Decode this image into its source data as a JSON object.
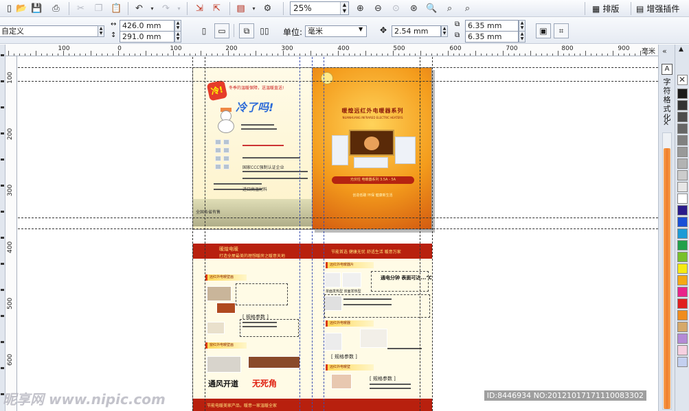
{
  "toolbar": {
    "zoom_value": "25%",
    "layout_label": "排版",
    "plugin_label": "增强插件",
    "icons": [
      "open-icon",
      "save-icon",
      "print-icon",
      "cut-icon",
      "copy-icon",
      "paste-icon",
      "undo-icon",
      "redo-icon",
      "import-icon",
      "export-icon",
      "publish-icon",
      "settings-icon",
      "zoom-in-icon",
      "zoom-out-icon",
      "zoom-fit-icon",
      "zoom-page-icon",
      "zoom-width-icon",
      "zoom-height-icon"
    ]
  },
  "property_bar": {
    "page_preset": "自定义",
    "width": "426.0 mm",
    "height": "291.0 mm",
    "unit_label": "单位:",
    "unit_value": "毫米",
    "nudge": "2.54 mm",
    "dup_x": "6.35 mm",
    "dup_y": "6.35 mm"
  },
  "ruler": {
    "h_labels": [
      "100",
      "0",
      "100",
      "200",
      "300",
      "400",
      "500",
      "600",
      "700",
      "800",
      "900"
    ],
    "unit": "毫米",
    "v_labels": [
      "100",
      "200",
      "300",
      "400",
      "500",
      "600"
    ]
  },
  "docker": {
    "title": "字符格式化"
  },
  "palette": {
    "colors": [
      "#1a1a1a",
      "#333333",
      "#4d4d4d",
      "#666666",
      "#808080",
      "#999999",
      "#b3b3b3",
      "#cccccc",
      "#e6e6e6",
      "#ffffff",
      "#2a1a8a",
      "#1a4fd6",
      "#1c9ad6",
      "#22a04a",
      "#78c02a",
      "#f5ea14",
      "#f5a714",
      "#e8238a",
      "#e01f1f",
      "#f08c1e",
      "#d6a96a",
      "#b48ad6",
      "#f5d0e0",
      "#c4d0f0"
    ]
  },
  "artwork": {
    "front_badge": "冷!",
    "front_tagline": "冬季的温暖保障，送温暖直送!",
    "front_title": "冷了吗!",
    "front_cert": "国家CCC强制认证企业",
    "front_material": "进口高温材料",
    "front_sales": "全国各省有售",
    "back_title": "暖煌远红外电暖器系列",
    "back_subtitle": "NUANHUANG INFRARED ELECTRIC HEATERS",
    "back_pill": "光伏柱 电暖器系列 3.5A - 5A",
    "back_slogan": "创造低碳  环保  健康新生活",
    "band_left_1": "暖煌电暖",
    "band_left_2": "打造全屋最美的理想暖房之暖意天地",
    "band_right": "节能首选  健康无忧  舒适生活  暖意万家",
    "sec_wall": "远红外电暖壁画",
    "sec_window": "窗红外电暖壁画",
    "sec_right_1": "远红外电暖器片",
    "sec_right_2": "远红外电暖器",
    "sec_right_3": "远红外电暖壁",
    "spec_label": "[ 规格参数 ]",
    "spec_label_r1": "[ 规格参数 ]",
    "spec_label_r2": "[ 规格参数 ]",
    "tagline_power": "通电分钟 表面可达...℃",
    "panel_labels": "单面发热型  双面发热型",
    "foot_bold": "通风开道",
    "foot_red": "无死角",
    "footer_band": "节能电暖美家产品，暖意一家温暖全家"
  },
  "watermark": "昵享网 www.nipic.com",
  "image_id": "ID:8446934 NO:20121017171110083302"
}
